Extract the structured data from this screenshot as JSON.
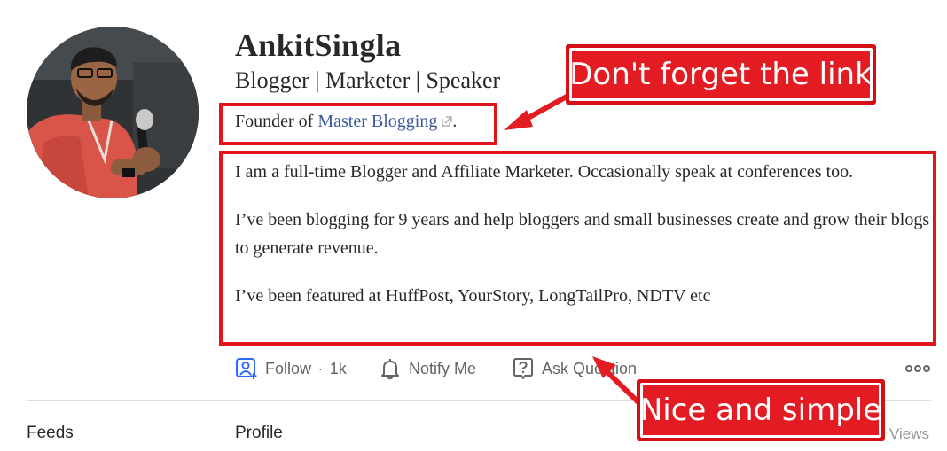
{
  "profile": {
    "name": "AnkitSingla",
    "tagline": "Blogger | Marketer | Speaker",
    "founder_prefix": "Founder of ",
    "founder_link": "Master Blogging",
    "founder_suffix": ".",
    "bio": [
      "I am a full-time Blogger and Affiliate Marketer. Occasionally speak at conferences too.",
      "I’ve been blogging for 9 years and help bloggers and small businesses create and grow their blogs to generate revenue.",
      "I’ve been featured at HuffPost, YourStory, LongTailPro, NDTV etc"
    ]
  },
  "actions": {
    "follow_label": "Follow",
    "follow_sep": "·",
    "follow_count": "1k",
    "notify_label": "Notify Me",
    "ask_label": "Ask Question",
    "more_icon": "more-dots-icon"
  },
  "tabs": {
    "feeds": "Feeds",
    "profile": "Profile",
    "views": "Views"
  },
  "annotations": {
    "link_callout": "Don't forget the link",
    "bio_callout": "Nice and simple"
  },
  "colors": {
    "annotation_red": "#e31b23",
    "link": "#3b5998",
    "follow_icon": "#2e69ff"
  }
}
